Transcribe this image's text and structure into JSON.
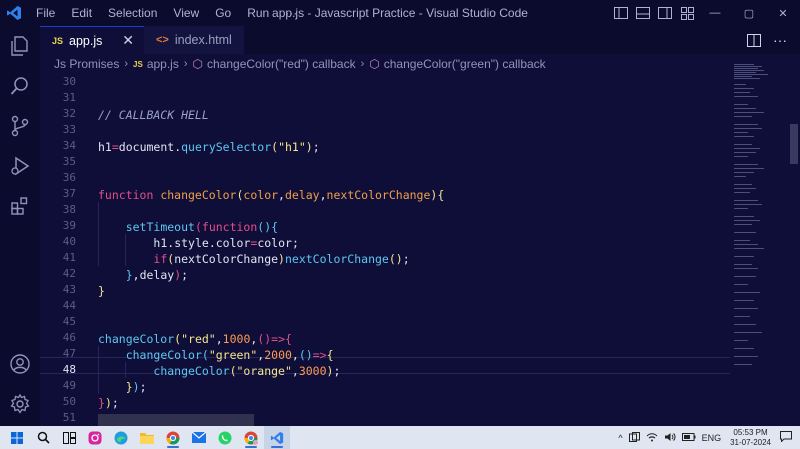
{
  "titlebar": {
    "menu": [
      "File",
      "Edit",
      "Selection",
      "View",
      "Go",
      "Run",
      "···"
    ],
    "window_title": "app.js - Javascript Practice - Visual Studio Code",
    "window_controls": [
      "—",
      "▢",
      "✕"
    ]
  },
  "activitybar": {
    "icons": [
      "explorer-icon",
      "search-icon",
      "source-control-icon",
      "run-debug-icon",
      "extensions-icon",
      "account-icon",
      "settings-gear-icon"
    ]
  },
  "tabs": [
    {
      "badge": "JS",
      "label": "app.js",
      "active": true,
      "close": "✕"
    },
    {
      "badge": "<>",
      "label": "index.html",
      "active": false
    }
  ],
  "breadcrumb": {
    "folder": "Js Promises",
    "file_badge": "JS",
    "file": "app.js",
    "symbol1": "changeColor(\"red\") callback",
    "symbol2": "changeColor(\"green\") callback",
    "separator": "›"
  },
  "editor": {
    "current_line": 48,
    "lines": [
      {
        "no": 30,
        "tokens": []
      },
      {
        "no": 31,
        "tokens": []
      },
      {
        "no": 32,
        "tokens": [
          {
            "t": "// CALLBACK HELL",
            "c": "cm"
          }
        ]
      },
      {
        "no": 33,
        "tokens": []
      },
      {
        "no": 34,
        "tokens": [
          {
            "t": "h1",
            "c": "id"
          },
          {
            "t": "=",
            "c": "op"
          },
          {
            "t": "document",
            "c": "id"
          },
          {
            "t": ".",
            "c": "id"
          },
          {
            "t": "querySelector",
            "c": "fn"
          },
          {
            "t": "(",
            "c": "par"
          },
          {
            "t": "\"h1\"",
            "c": "str"
          },
          {
            "t": ")",
            "c": "par"
          },
          {
            "t": ";",
            "c": "id"
          }
        ]
      },
      {
        "no": 35,
        "tokens": []
      },
      {
        "no": 36,
        "tokens": []
      },
      {
        "no": 37,
        "tokens": [
          {
            "t": "function ",
            "c": "kw"
          },
          {
            "t": "changeColor",
            "c": "fnd"
          },
          {
            "t": "(",
            "c": "par"
          },
          {
            "t": "color",
            "c": "arg"
          },
          {
            "t": ",",
            "c": "id"
          },
          {
            "t": "delay",
            "c": "arg"
          },
          {
            "t": ",",
            "c": "id"
          },
          {
            "t": "nextColorChange",
            "c": "arg"
          },
          {
            "t": ")",
            "c": "par"
          },
          {
            "t": "{",
            "c": "par"
          }
        ]
      },
      {
        "no": 38,
        "tokens": []
      },
      {
        "no": 39,
        "tokens": [
          {
            "t": "    ",
            "c": "id"
          },
          {
            "t": "setTimeout",
            "c": "fn"
          },
          {
            "t": "(",
            "c": "kw"
          },
          {
            "t": "function",
            "c": "kw"
          },
          {
            "t": "(){",
            "c": "fn"
          }
        ]
      },
      {
        "no": 40,
        "tokens": [
          {
            "t": "        ",
            "c": "id"
          },
          {
            "t": "h1",
            "c": "id"
          },
          {
            "t": ".",
            "c": "id"
          },
          {
            "t": "style",
            "c": "prop"
          },
          {
            "t": ".",
            "c": "id"
          },
          {
            "t": "color",
            "c": "prop"
          },
          {
            "t": "=",
            "c": "op"
          },
          {
            "t": "color",
            "c": "id"
          },
          {
            "t": ";",
            "c": "id"
          }
        ]
      },
      {
        "no": 41,
        "tokens": [
          {
            "t": "        ",
            "c": "id"
          },
          {
            "t": "if",
            "c": "kw"
          },
          {
            "t": "(",
            "c": "par"
          },
          {
            "t": "nextColorChange",
            "c": "id"
          },
          {
            "t": ")",
            "c": "par"
          },
          {
            "t": "nextColorChange",
            "c": "fn"
          },
          {
            "t": "()",
            "c": "par"
          },
          {
            "t": ";",
            "c": "id"
          }
        ]
      },
      {
        "no": 42,
        "tokens": [
          {
            "t": "    ",
            "c": "id"
          },
          {
            "t": "}",
            "c": "fn"
          },
          {
            "t": ",",
            "c": "id"
          },
          {
            "t": "delay",
            "c": "id"
          },
          {
            "t": ")",
            "c": "kw"
          },
          {
            "t": ";",
            "c": "id"
          }
        ]
      },
      {
        "no": 43,
        "tokens": [
          {
            "t": "}",
            "c": "par"
          }
        ]
      },
      {
        "no": 44,
        "tokens": []
      },
      {
        "no": 45,
        "tokens": []
      },
      {
        "no": 46,
        "tokens": [
          {
            "t": "changeColor",
            "c": "fn"
          },
          {
            "t": "(",
            "c": "par"
          },
          {
            "t": "\"red\"",
            "c": "str"
          },
          {
            "t": ",",
            "c": "id"
          },
          {
            "t": "1000",
            "c": "num"
          },
          {
            "t": ",",
            "c": "id"
          },
          {
            "t": "()",
            "c": "kw"
          },
          {
            "t": "=>",
            "c": "op"
          },
          {
            "t": "{",
            "c": "kw"
          }
        ]
      },
      {
        "no": 47,
        "tokens": [
          {
            "t": "    ",
            "c": "id"
          },
          {
            "t": "changeColor",
            "c": "fn"
          },
          {
            "t": "(",
            "c": "fn"
          },
          {
            "t": "\"green\"",
            "c": "str"
          },
          {
            "t": ",",
            "c": "id"
          },
          {
            "t": "2000",
            "c": "num"
          },
          {
            "t": ",",
            "c": "id"
          },
          {
            "t": "()",
            "c": "fn"
          },
          {
            "t": "=>",
            "c": "op"
          },
          {
            "t": "{",
            "c": "par"
          }
        ]
      },
      {
        "no": 48,
        "tokens": [
          {
            "t": "        ",
            "c": "id"
          },
          {
            "t": "changeColor",
            "c": "fn"
          },
          {
            "t": "(",
            "c": "par"
          },
          {
            "t": "\"orange\"",
            "c": "str"
          },
          {
            "t": ",",
            "c": "id"
          },
          {
            "t": "3000",
            "c": "num"
          },
          {
            "t": ")",
            "c": "par"
          },
          {
            "t": ";",
            "c": "id"
          }
        ]
      },
      {
        "no": 49,
        "tokens": [
          {
            "t": "    ",
            "c": "id"
          },
          {
            "t": "}",
            "c": "par"
          },
          {
            "t": ")",
            "c": "fn"
          },
          {
            "t": ";",
            "c": "id"
          }
        ]
      },
      {
        "no": 50,
        "tokens": [
          {
            "t": "}",
            "c": "kw"
          },
          {
            "t": ")",
            "c": "par"
          },
          {
            "t": ";",
            "c": "id"
          }
        ]
      },
      {
        "no": 51,
        "tokens": []
      }
    ]
  },
  "taskbar": {
    "icons": [
      "windows-start-icon",
      "search-icon",
      "task-view-icon",
      "instagram-icon",
      "edge-icon",
      "file-explorer-icon",
      "chrome-icon",
      "mail-icon",
      "whatsapp-icon",
      "chrome-profile-icon",
      "vscode-icon"
    ],
    "tray": {
      "chevron": "^",
      "lang": "ENG",
      "time": "05:53 PM",
      "date": "31-07-2024"
    }
  },
  "colors": {
    "background": "#0b0b2e",
    "editor_bg": "#0e0e38",
    "accent": "#1e3bd6",
    "keyword": "#e34f8a",
    "function": "#5ec7f0",
    "string": "#f6e58d",
    "number": "#ff9b50"
  }
}
